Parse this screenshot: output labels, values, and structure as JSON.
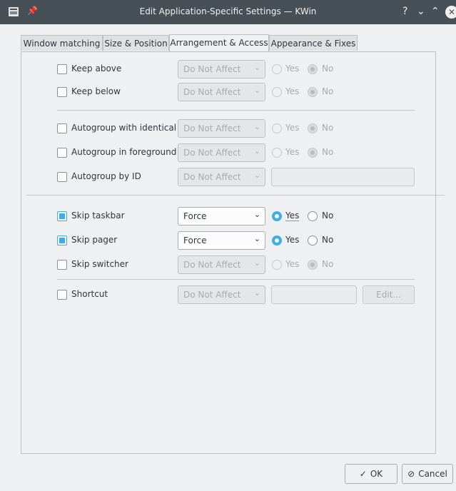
{
  "window": {
    "title": "Edit Application-Specific Settings — KWin",
    "help_glyph": "?",
    "minimize_glyph": "⌄",
    "maximize_glyph": "⌃",
    "close_glyph": "✕",
    "pin_glyph": "📌"
  },
  "tabs": [
    {
      "label": "Window matching"
    },
    {
      "label": "Size & Position"
    },
    {
      "label": "Arrangement & Access",
      "active": true
    },
    {
      "label": "Appearance & Fixes"
    }
  ],
  "rules": {
    "keep_above": {
      "label": "Keep above",
      "checked": false,
      "policy": "Do Not Affect",
      "yes": "Yes",
      "no": "No",
      "value": "No"
    },
    "keep_below": {
      "label": "Keep below",
      "checked": false,
      "policy": "Do Not Affect",
      "yes": "Yes",
      "no": "No",
      "value": "No"
    },
    "autogroup_identical": {
      "label": "Autogroup with identical",
      "checked": false,
      "policy": "Do Not Affect",
      "yes": "Yes",
      "no": "No",
      "value": "No"
    },
    "autogroup_foreground": {
      "label": "Autogroup in foreground",
      "checked": false,
      "policy": "Do Not Affect",
      "yes": "Yes",
      "no": "No",
      "value": "No"
    },
    "autogroup_id": {
      "label": "Autogroup by ID",
      "checked": false,
      "policy": "Do Not Affect",
      "text": ""
    },
    "skip_taskbar": {
      "label": "Skip taskbar",
      "checked": true,
      "policy": "Force",
      "yes": "Yes",
      "no": "No",
      "value": "Yes"
    },
    "skip_pager": {
      "label": "Skip pager",
      "checked": true,
      "policy": "Force",
      "yes": "Yes",
      "no": "No",
      "value": "Yes"
    },
    "skip_switcher": {
      "label": "Skip switcher",
      "checked": false,
      "policy": "Do Not Affect",
      "yes": "Yes",
      "no": "No",
      "value": "No"
    },
    "shortcut": {
      "label": "Shortcut",
      "checked": false,
      "policy": "Do Not Affect",
      "text": "",
      "edit_label": "Edit..."
    }
  },
  "buttons": {
    "ok_label": "OK",
    "ok_icon": "✓",
    "cancel_label": "Cancel",
    "cancel_icon": "⃠"
  },
  "colors": {
    "accent": "#3daee9",
    "titlebar": "#475057",
    "background": "#eff0f1"
  }
}
